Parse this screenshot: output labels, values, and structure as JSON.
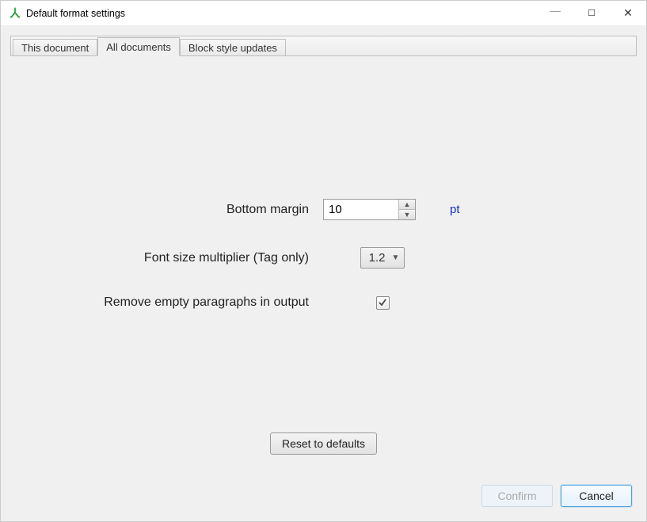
{
  "window": {
    "title": "Default format settings"
  },
  "tabs": {
    "this_document": "This document",
    "all_documents": "All documents",
    "block_style": "Block style updates"
  },
  "form": {
    "bottom_margin_label": "Bottom margin",
    "bottom_margin_value": "10",
    "bottom_margin_unit": "pt",
    "font_mult_label": "Font size multiplier (Tag only)",
    "font_mult_value": "1.2",
    "remove_empty_label": "Remove empty paragraphs in output",
    "remove_empty_checked": true
  },
  "buttons": {
    "reset": "Reset to defaults",
    "confirm": "Confirm",
    "cancel": "Cancel"
  }
}
